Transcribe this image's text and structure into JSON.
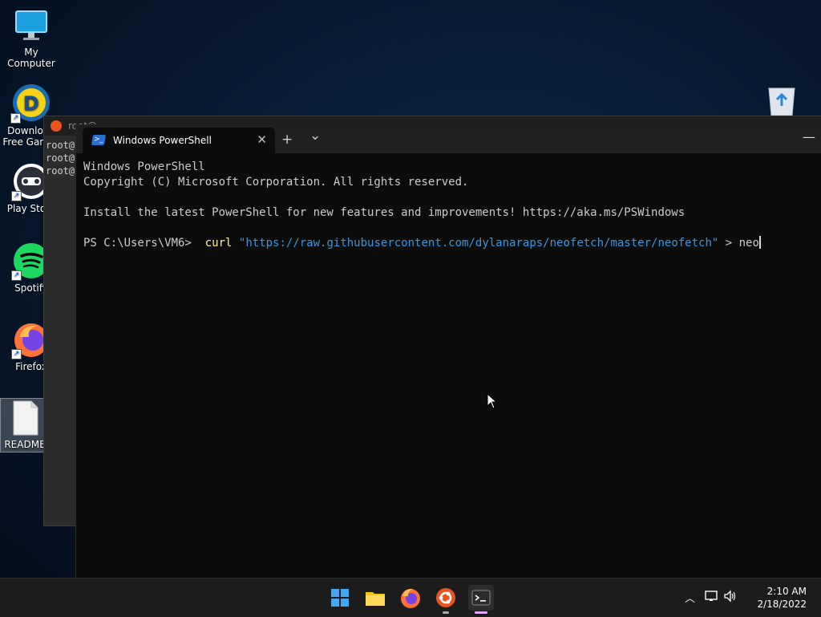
{
  "desktop": {
    "icons": [
      {
        "label": "My Computer"
      },
      {
        "label": "Download Free Games"
      },
      {
        "label": "Play Store"
      },
      {
        "label": "Spotify"
      },
      {
        "label": "Firefox"
      },
      {
        "label": "README"
      }
    ],
    "recycle_bin_icon": "recycle-bin-icon"
  },
  "ubuntu_window": {
    "title": "root@",
    "lines": [
      "root@",
      "root@",
      "root@"
    ]
  },
  "terminal": {
    "tab_title": "Windows PowerShell",
    "new_tab_label": "+",
    "dropdown_label": "⌄",
    "minimize_label": "—",
    "lines": {
      "line1": "Windows PowerShell",
      "line2": "Copyright (C) Microsoft Corporation. All rights reserved.",
      "line3": "Install the latest PowerShell for new features and improvements! https://aka.ms/PSWindows",
      "prompt": "PS C:\\Users\\VM6> ",
      "command": "curl",
      "argument": "\"https://raw.githubusercontent.com/dylanaraps/neofetch/master/neofetch\"",
      "redirect": " > neo"
    }
  },
  "taskbar": {
    "apps": [
      "start-icon",
      "file-explorer-icon",
      "firefox-icon",
      "ubuntu-icon",
      "terminal-icon"
    ],
    "time": "2:10 AM",
    "date": "2/18/2022"
  },
  "colors": {
    "terminal_bg": "#0c0c0c",
    "string": "#3a96dd",
    "command": "#f9f1a5",
    "taskbar_bg": "#1c1c1c"
  }
}
